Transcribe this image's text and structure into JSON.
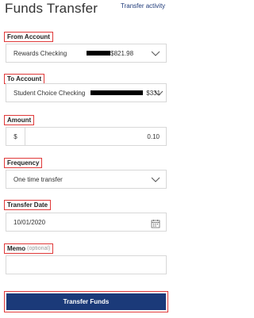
{
  "header": {
    "title": "Funds Transfer",
    "activity_link": "Transfer activity"
  },
  "from_account": {
    "label": "From Account",
    "name": "Rewards Checking",
    "balance": "$821.98"
  },
  "to_account": {
    "label": "To Account",
    "name": "Student Choice Checking",
    "balance": "$331"
  },
  "amount": {
    "label": "Amount",
    "currency_symbol": "$",
    "value": "0.10"
  },
  "frequency": {
    "label": "Frequency",
    "value": "One time transfer"
  },
  "transfer_date": {
    "label": "Transfer Date",
    "value": "10/01/2020"
  },
  "memo": {
    "label": "Memo",
    "optional_note": "(optional)",
    "value": ""
  },
  "submit": {
    "label": "Transfer Funds"
  },
  "colors": {
    "highlight": "#e03a3a",
    "primary": "#1b3a79"
  },
  "icons": {
    "select": "chevron-down-icon",
    "date": "calendar-icon"
  }
}
